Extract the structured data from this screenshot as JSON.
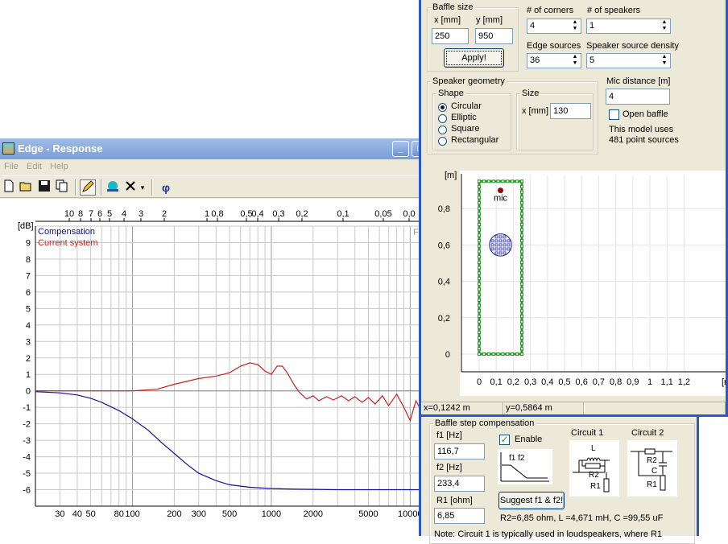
{
  "response_window": {
    "title": "Edge - Response",
    "menu": [
      "File",
      "Edit",
      "Help"
    ],
    "toolbar_icons": [
      "new-file-icon",
      "open-folder-icon",
      "save-icon",
      "copy-icon",
      "pencil-icon",
      "globe-icon",
      "delete-icon",
      "dropdown-icon",
      "phi-icon"
    ],
    "phi_label": "φ",
    "minimize": "_",
    "maximize": "□"
  },
  "chart_data": {
    "type": "line",
    "ylabel": "[dB]",
    "xscale": "log",
    "xlim": [
      20,
      12000
    ],
    "ylim": [
      -7,
      10
    ],
    "y_ticks": [
      9,
      8,
      7,
      6,
      5,
      4,
      3,
      2,
      1,
      0,
      -1,
      -2,
      -3,
      -4,
      -5,
      -6
    ],
    "x_tick_labels": [
      "30",
      "40",
      "50",
      "80",
      "100",
      "200",
      "300",
      "500",
      "1000",
      "2000",
      "5000",
      "10000"
    ],
    "top_axis_labels": [
      "10",
      "8",
      "7",
      "6",
      "5",
      "4",
      "3",
      "2",
      "1",
      "0,8",
      "0,5",
      "0,4",
      "0,3",
      "0,2",
      "0,1",
      "0,05",
      "0,0"
    ],
    "top_axis_cut_label": "F",
    "grid": true,
    "legend_position": "top-left",
    "series": [
      {
        "name": "Compensation",
        "color": "#1010a0",
        "x": [
          20,
          30,
          40,
          50,
          60,
          80,
          100,
          130,
          160,
          200,
          250,
          300,
          400,
          500,
          700,
          1000,
          1500,
          2000,
          3000,
          5000,
          10000,
          12000
        ],
        "y": [
          -0.05,
          -0.12,
          -0.25,
          -0.45,
          -0.7,
          -1.2,
          -1.7,
          -2.4,
          -3.1,
          -3.8,
          -4.5,
          -5.0,
          -5.45,
          -5.7,
          -5.85,
          -5.93,
          -5.97,
          -5.98,
          -6.0,
          -6.0,
          -6.0,
          -6.0
        ]
      },
      {
        "name": "Current system",
        "color": "#cc2020",
        "x": [
          20,
          50,
          100,
          150,
          200,
          300,
          400,
          500,
          600,
          700,
          800,
          900,
          1000,
          1100,
          1200,
          1300,
          1450,
          1600,
          1800,
          2000,
          2200,
          2500,
          2800,
          3200,
          3600,
          4000,
          4500,
          5000,
          5600,
          6300,
          7000,
          8000,
          9000,
          10000,
          11000,
          12000
        ],
        "y": [
          0.0,
          0.0,
          0.0,
          0.1,
          0.4,
          0.75,
          0.9,
          1.1,
          1.5,
          1.7,
          1.6,
          1.2,
          1.0,
          1.5,
          1.5,
          1.1,
          0.4,
          -0.1,
          -0.5,
          -0.3,
          -0.6,
          -0.35,
          -0.55,
          -0.3,
          -0.6,
          -0.35,
          -0.7,
          -0.4,
          -0.8,
          -0.3,
          -0.9,
          -0.2,
          -1.0,
          -1.8,
          -0.6,
          -1.2
        ]
      }
    ]
  },
  "settings": {
    "baffle_size": {
      "label": "Baffle size",
      "x_label": "x [mm]",
      "y_label": "y [mm]",
      "x_value": "250",
      "y_value": "950",
      "apply": "Apply!"
    },
    "corners": {
      "label": "# of corners",
      "value": "4"
    },
    "speakers": {
      "label": "# of speakers",
      "value": "1"
    },
    "edge_sources": {
      "label": "Edge sources",
      "value": "36"
    },
    "density": {
      "label": "Speaker source density",
      "value": "5"
    },
    "geometry": {
      "label": "Speaker geometry",
      "shape_label": "Shape",
      "shapes": [
        "Circular",
        "Elliptic",
        "Square",
        "Rectangular"
      ],
      "selected_shape": "Circular",
      "size_label": "Size",
      "size_unit": "x [mm]",
      "size_value": "130"
    },
    "mic": {
      "label": "Mic distance [m]",
      "value": "4",
      "open_baffle": "Open baffle",
      "open_baffle_checked": false,
      "note_line1": "This model uses",
      "note_line2": "481 point sources"
    }
  },
  "geometry_plot": {
    "unit_y": "[m]",
    "unit_x": "[m",
    "y_ticks": [
      "0,8",
      "0,6",
      "0,4",
      "0,2",
      "0"
    ],
    "x_ticks": [
      "0",
      "0,1",
      "0,2",
      "0,3",
      "0,4",
      "0,5",
      "0,6",
      "0,7",
      "0,8",
      "0,9",
      "1",
      "1,1",
      "1,2"
    ],
    "mic_label": "mic",
    "baffle_w_m": 0.25,
    "baffle_h_m": 0.95,
    "speaker_center_m": [
      0.125,
      0.6
    ],
    "speaker_diam_m": 0.13,
    "mic_pos_m": [
      0.125,
      0.9
    ],
    "status_x": "x=0,1242 m",
    "status_y": "y=0,5864 m"
  },
  "bsc": {
    "title": "Baffle step compensation",
    "f1_label": "f1 [Hz]",
    "f1_value": "116,7",
    "f2_label": "f2 [Hz]",
    "f2_value": "233,4",
    "r1_label": "R1 [ohm]",
    "r1_value": "6,85",
    "enable": "Enable",
    "enable_checked": true,
    "mini_plot_label": "f1 f2",
    "circuit1": "Circuit 1",
    "circuit2": "Circuit 2",
    "c1_L": "L",
    "c1_R2": "R2",
    "c1_R1": "R1",
    "c2_R2": "R2",
    "c2_C": "C",
    "c2_R1": "R1",
    "suggest": "Suggest f1 & f2!",
    "result": "R2=6,85 ohm, L =4,671 mH, C =99,55 uF",
    "note": "Note: Circuit 1 is typically used in loudspeakers, where R1"
  }
}
